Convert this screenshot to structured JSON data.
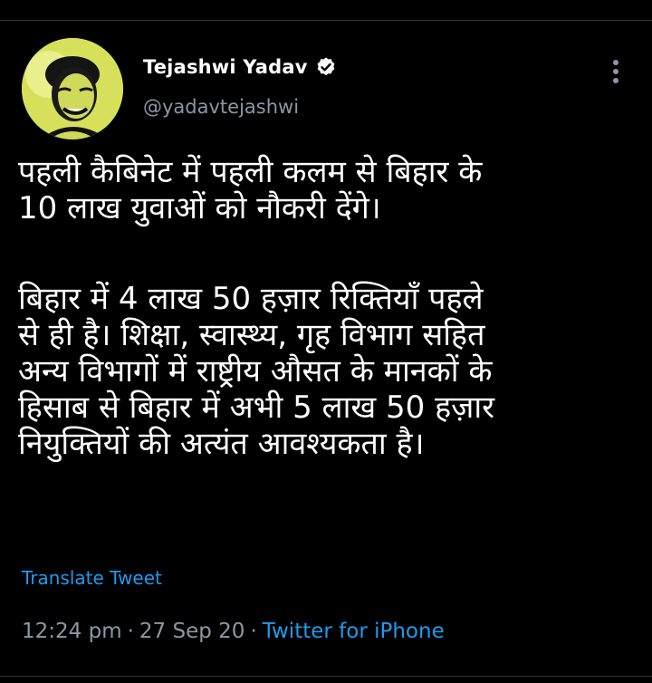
{
  "tweet": {
    "author_name": "Tejashwi Yadav",
    "author_handle": "@yadavtejashwi",
    "verified_icon": "verified-badge-icon",
    "paragraph_1": [
      "पहली कैबिनेट में पहली कलम से बिहार के",
      "10 लाख युवाओं को नौकरी देंगे।"
    ],
    "paragraph_2": [
      "बिहार में 4 लाख 50 हज़ार रिक्तियाँ पहले",
      "से ही है। शिक्षा, स्वास्थ्य, गृह विभाग सहित",
      "अन्य विभागों में राष्ट्रीय औसत के मानकों के",
      "हिसाब से बिहार में अभी 5 लाख 50 हज़ार",
      "नियुक्तियों की अत्यंत आवश्यकता है।"
    ],
    "translate_label": "Translate Tweet",
    "time": "12:24 pm",
    "separator": "·",
    "date": "27 Sep 20",
    "source": "Twitter for iPhone"
  },
  "colors": {
    "background": "#000000",
    "text": "#ffffff",
    "secondary_text": "#8b98a5",
    "link": "#1d9bf0",
    "avatar_bg": "#d8e35c"
  },
  "icons": {
    "more": "more-vertical-icon",
    "verified": "verified-badge-icon"
  }
}
